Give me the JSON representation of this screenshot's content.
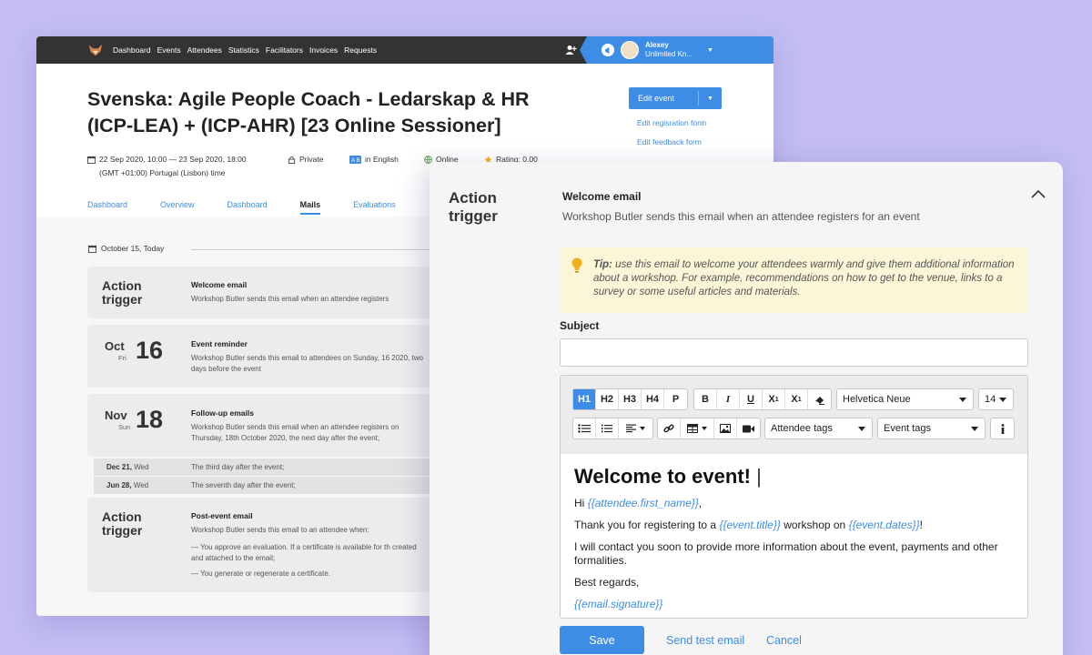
{
  "colors": {
    "accent": "#3d8de6",
    "background": "#c3bdf4",
    "topbar": "#333333",
    "tip_bg": "#fbf6d8"
  },
  "app": {
    "nav": [
      "Dashboard",
      "Events",
      "Attendees",
      "Statistics",
      "Facilitators",
      "Invoices",
      "Requests"
    ],
    "user": {
      "name": "Alexey",
      "org": "Unlimited Kn..."
    },
    "event_title": "Svenska: Agile People Coach - Ledarskap & HR (ICP-LEA) + (ICP-AHR) [23 Online Sessioner]",
    "edit_event_label": "Edit event",
    "edit_registration_link": "Edit regisration form",
    "edit_feedback_link": "Edit feedback form",
    "meta": {
      "dates": "22 Sep 2020, 10:00 — 23 Sep 2020, 18:00",
      "timezone": "(GMT +01:00) Portugal (Lisbon) time",
      "privacy": "Private",
      "language": "in English",
      "location": "Online",
      "rating": "Rating: 0.00"
    },
    "tabs": [
      "Dashboard",
      "Overview",
      "Dashboard",
      "Mails",
      "Evaluations"
    ],
    "active_tab": "Mails",
    "today_label": "October 15, Today",
    "cards": [
      {
        "trigger": "Action trigger",
        "heading": "Welcome email",
        "text": "Workshop Butler sends this email when an attendee registers"
      },
      {
        "month": "Oct",
        "weekday": "Fri",
        "day": "16",
        "heading": "Event reminder",
        "text": "Workshop Butler sends this email to attendees on Sunday, 16 2020, two days before the event"
      },
      {
        "month": "Nov",
        "weekday": "Sun",
        "day": "18",
        "heading": "Follow-up emails",
        "text": "Workshop Butler sends this email when an attendee registers on Thursday, 18th October 2020, the next day after the event;"
      },
      {
        "trigger": "Action trigger",
        "heading": "Post-event email",
        "text": "Workshop Butler sends this email to an attendee when:",
        "bullet1": "— You approve an evaluation. If a certificate is available for th created and attached to the email;",
        "bullet2": "— You generate or regenerate a certificate."
      }
    ],
    "subrows": [
      {
        "date": "Dec 21,",
        "dow": "Wed",
        "text": "The third day after the event;"
      },
      {
        "date": "Jun 28,",
        "dow": "Wed",
        "text": "The seventh day after the event;"
      }
    ]
  },
  "panel": {
    "trigger": "Action trigger",
    "title": "Welcome email",
    "description": "Workshop Butler sends this email when an attendee registers for an event",
    "tip_label": "Tip:",
    "tip_text": "use this email to welcome your attendees warmly and give them additional information about a workshop. For example, recommendations on how to get to the venue, links to a survey or some useful articles and materials.",
    "subject_label": "Subject",
    "subject_value": "",
    "toolbar": {
      "headings": [
        "H1",
        "H2",
        "H3",
        "H4",
        "P"
      ],
      "active_heading": "H1",
      "font": "Helvetica Neue",
      "size": "14",
      "attendee_tags": "Attendee tags",
      "event_tags": "Event tags"
    },
    "body": {
      "heading": "Welcome to event!",
      "greeting": "Hi",
      "var_first_name": "{{attendee.first_name}}",
      "comma": ",",
      "line1_a": "Thank you for registering to a",
      "var_title": "{{event.title}}",
      "line1_b": "workshop on",
      "var_dates": "{{event.dates}}",
      "line1_c": "!",
      "line2": "I will contact you soon to provide more information about the event, payments and other formalities.",
      "line3": "Best regards,",
      "var_signature": "{{email.signature}}"
    },
    "save_label": "Save",
    "test_label": "Send test email",
    "cancel_label": "Cancel"
  }
}
